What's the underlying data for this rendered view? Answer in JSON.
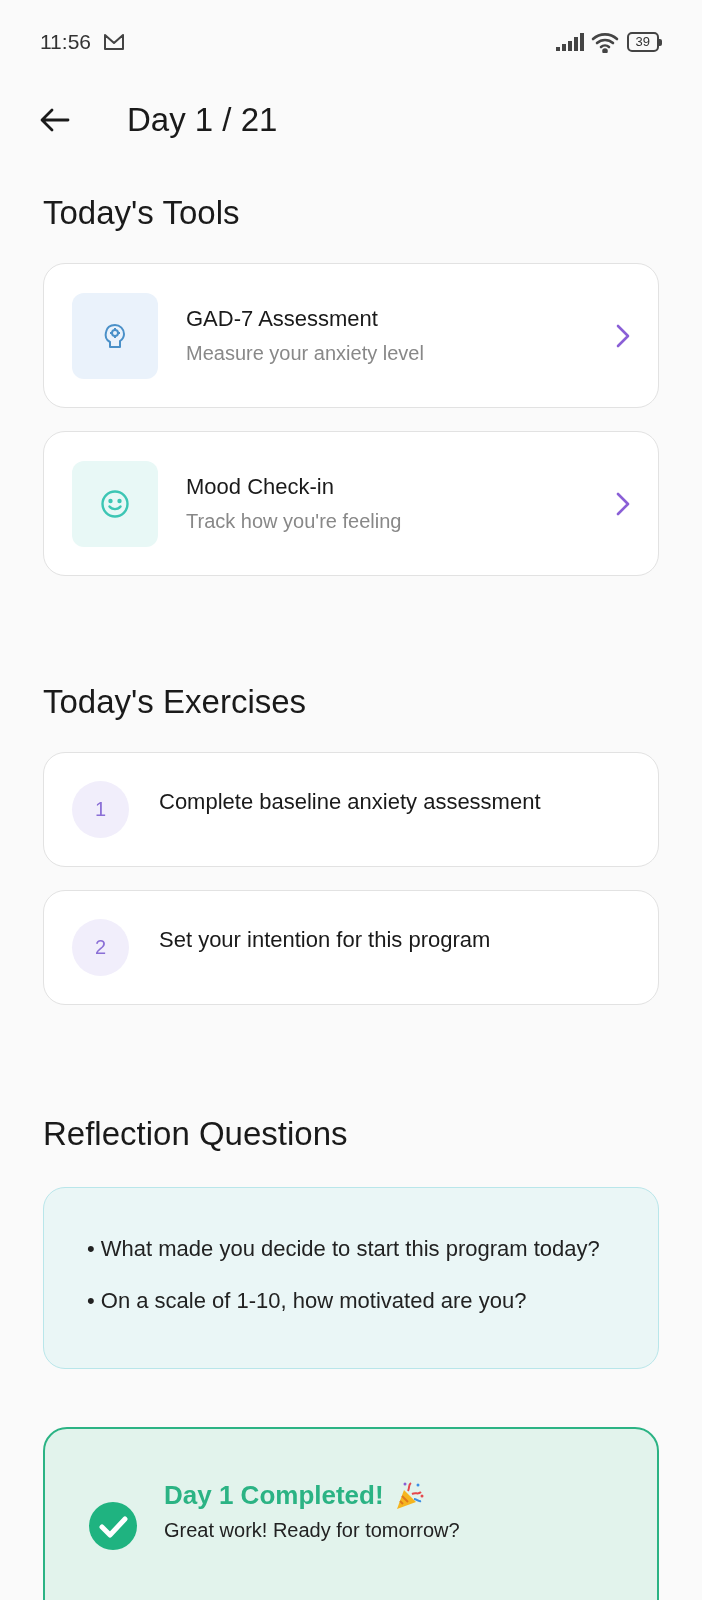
{
  "status_bar": {
    "time": "11:56",
    "battery": "39"
  },
  "header": {
    "title": "Day 1 / 21"
  },
  "tools": {
    "heading": "Today's Tools",
    "items": [
      {
        "kind": "brain",
        "title": "GAD-7 Assessment",
        "subtitle": "Measure your anxiety level"
      },
      {
        "kind": "smile",
        "title": "Mood Check-in",
        "subtitle": "Track how you're feeling"
      }
    ]
  },
  "exercises": {
    "heading": "Today's Exercises",
    "items": [
      {
        "number": "1",
        "text": "Complete baseline anxiety assessment"
      },
      {
        "number": "2",
        "text": "Set your intention for this program"
      }
    ]
  },
  "reflection": {
    "heading": "Reflection Questions",
    "questions": [
      "• What made you decide to start this program today?",
      "• On a scale of 1-10, how motivated are you?"
    ]
  },
  "completion": {
    "completed": true,
    "title": "Day 1 Completed!",
    "message": "Great work! Ready for tomorrow?"
  }
}
